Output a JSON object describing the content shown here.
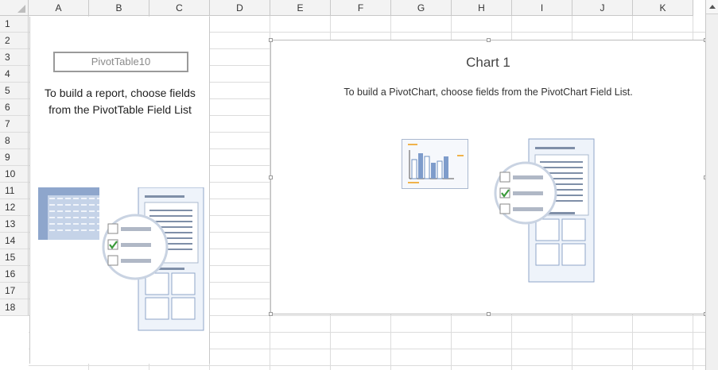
{
  "columns": [
    "A",
    "B",
    "C",
    "D",
    "E",
    "F",
    "G",
    "H",
    "I",
    "J",
    "K"
  ],
  "rows": [
    "1",
    "2",
    "3",
    "4",
    "5",
    "6",
    "7",
    "8",
    "9",
    "10",
    "11",
    "12",
    "13",
    "14",
    "15",
    "16",
    "17",
    "18"
  ],
  "pivot_table": {
    "name": "PivotTable10",
    "instruction": "To build a report, choose fields from the PivotTable Field List"
  },
  "pivot_chart": {
    "title": "Chart 1",
    "instruction": "To build a PivotChart, choose fields from the PivotChart Field List."
  },
  "colors": {
    "grid_line": "#dcdcdc",
    "header_bg": "#f3f3f3",
    "illustration_blue": "#6f8fbf",
    "illustration_light": "#e8eef8",
    "checkmark_green": "#3a9a3a"
  },
  "icons": {
    "pivot_table_illustration": "pivot-table-field-list-icon",
    "pivot_chart_illustration": "pivot-chart-field-list-icon",
    "scroll_up": "scroll-up-arrow-icon"
  }
}
